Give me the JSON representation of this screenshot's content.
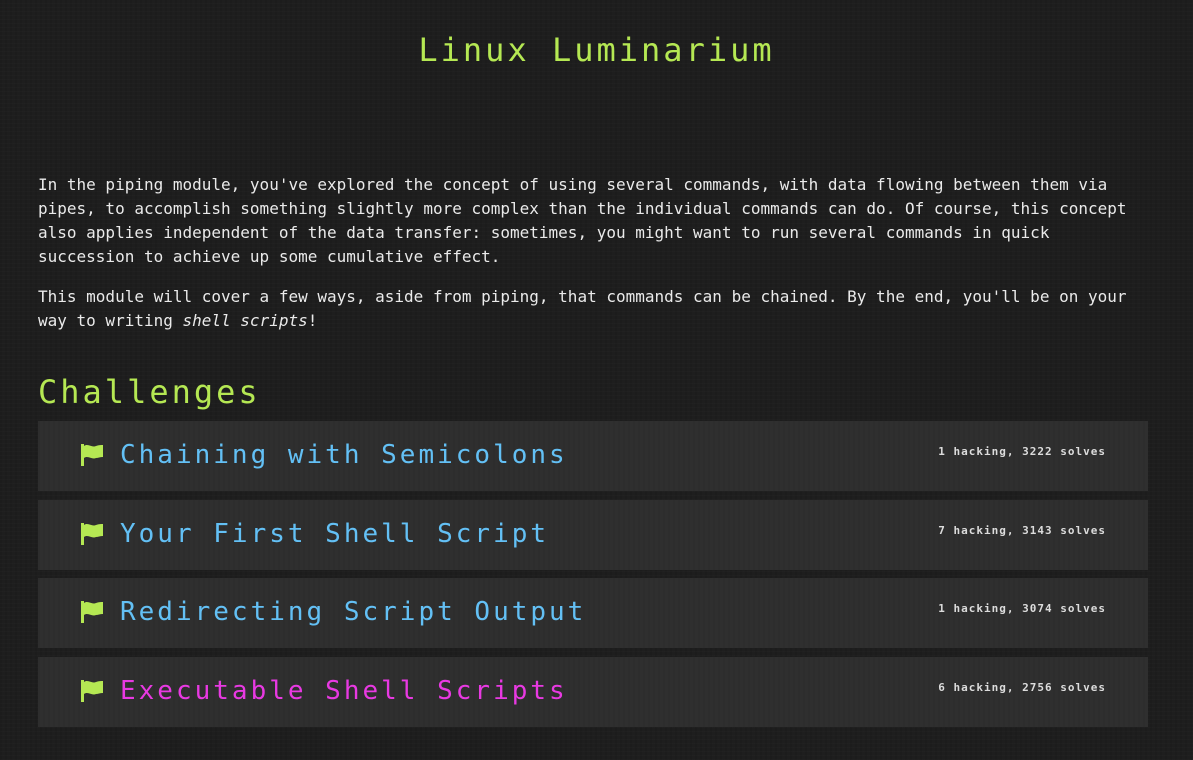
{
  "module": {
    "title": "Linux Luminarium"
  },
  "description": {
    "paragraph1": "In the piping module, you've explored the concept of using several commands, with data flowing between them via pipes, to accomplish something slightly more complex than the individual commands can do. Of course, this concept also applies independent of the data transfer: sometimes, you might want to run several commands in quick succession to achieve up some cumulative effect.",
    "paragraph2_before": "This module will cover a few ways, aside from piping, that commands can be chained. By the end, you'll be on your way to writing ",
    "paragraph2_em": "shell scripts",
    "paragraph2_after": "!"
  },
  "challenges_heading": "Challenges",
  "colors": {
    "accent_green": "#b5e853",
    "link_blue": "#63c0f5",
    "active_magenta": "#e839e2",
    "card_bg": "#2f2f2f",
    "page_bg": "#1e1e1e"
  },
  "challenges": [
    {
      "icon": "flag-icon",
      "name": "Chaining with Semicolons",
      "stats": "1 hacking, 3222 solves"
    },
    {
      "icon": "flag-icon",
      "name": "Your First Shell Script",
      "stats": "7 hacking, 3143 solves"
    },
    {
      "icon": "flag-icon",
      "name": "Redirecting Script Output",
      "stats": "1 hacking, 3074 solves"
    },
    {
      "icon": "flag-icon",
      "name": "Executable Shell Scripts",
      "stats": "6 hacking, 2756 solves"
    }
  ]
}
